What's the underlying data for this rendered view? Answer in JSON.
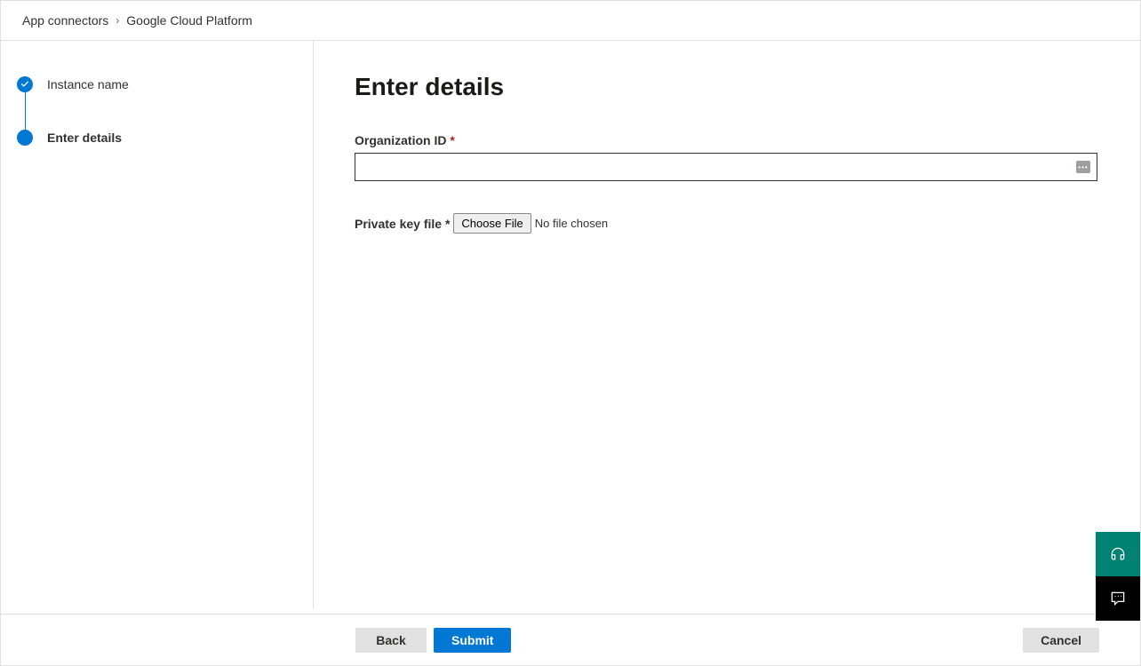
{
  "breadcrumb": {
    "parent": "App connectors",
    "current": "Google Cloud Platform"
  },
  "sidebar": {
    "steps": [
      {
        "label": "Instance name",
        "state": "completed"
      },
      {
        "label": "Enter details",
        "state": "current"
      }
    ]
  },
  "content": {
    "title": "Enter details",
    "org_id_label": "Organization ID",
    "org_id_value": "",
    "private_key_label": "Private key file",
    "choose_file_label": "Choose File",
    "file_status": "No file chosen"
  },
  "footer": {
    "back_label": "Back",
    "submit_label": "Submit",
    "cancel_label": "Cancel"
  }
}
